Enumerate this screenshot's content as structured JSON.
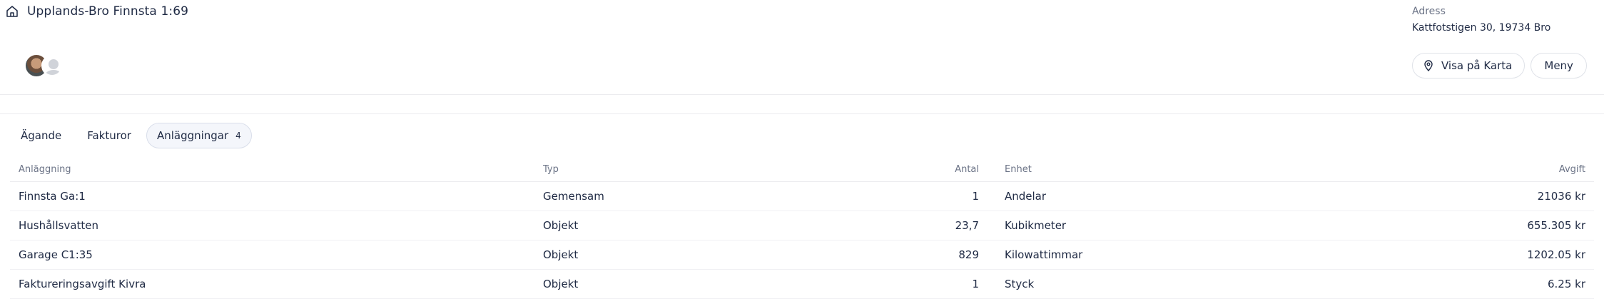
{
  "header": {
    "title": "Upplands-Bro Finnsta 1:69",
    "home_icon": "home-icon",
    "address_label": "Adress",
    "address_value": "Kattfotstigen 30, 19734 Bro",
    "show_map_label": "Visa på Karta",
    "show_map_icon": "map-pin-icon",
    "menu_label": "Meny"
  },
  "avatars": [
    "user-photo-avatar",
    "placeholder-avatar"
  ],
  "tabs": [
    {
      "label": "Ägande",
      "active": false
    },
    {
      "label": "Fakturor",
      "active": false
    },
    {
      "label": "Anläggningar",
      "count": "4",
      "active": true
    }
  ],
  "table": {
    "columns": [
      "Anläggning",
      "Typ",
      "Antal",
      "Enhet",
      "Avgift"
    ],
    "rows": [
      [
        "Finnsta Ga:1",
        "Gemensam",
        "1",
        "Andelar",
        "21036 kr"
      ],
      [
        "Hushållsvatten",
        "Objekt",
        "23,7",
        "Kubikmeter",
        "655.305 kr"
      ],
      [
        "Garage C1:35",
        "Objekt",
        "829",
        "Kilowattimmar",
        "1202.05 kr"
      ],
      [
        "Faktureringsavgift Kivra",
        "Objekt",
        "1",
        "Styck",
        "6.25 kr"
      ]
    ]
  },
  "colors": {
    "text": "#1f2a44",
    "muted": "#6b7386",
    "border": "#ececef",
    "active_tab_bg": "#f4f6fb"
  }
}
